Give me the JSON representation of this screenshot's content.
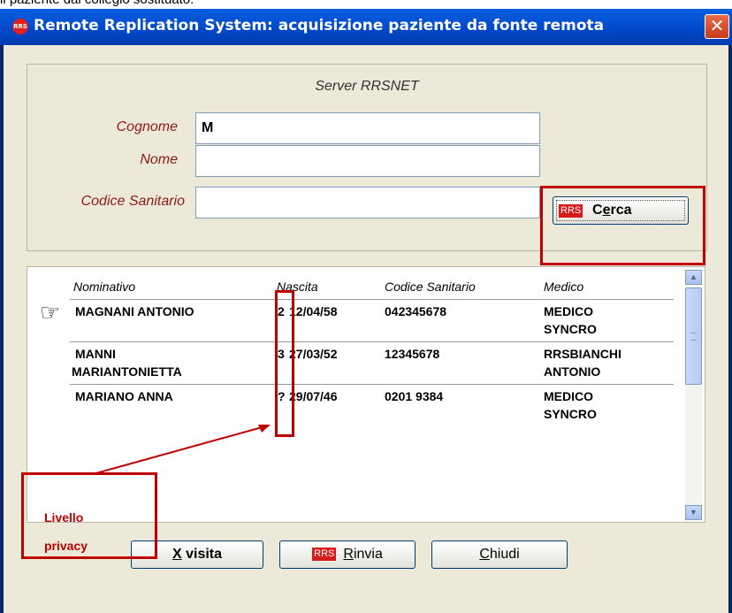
{
  "caption": "il paziente dal collegio sostituato.",
  "window": {
    "title": "Remote Replication System: acquisizione paziente da fonte remota",
    "icon_text": "RRS",
    "close_glyph": "✕"
  },
  "search": {
    "server_label": "Server RRSNET",
    "cognome_label": "Cognome",
    "cognome_value": "M",
    "nome_label": "Nome",
    "nome_value": "",
    "codice_label": "Codice Sanitario",
    "codice_value": "",
    "cerca_logo": "RRS",
    "cerca_prefix": "C",
    "cerca_underline": "e",
    "cerca_suffix": "rca"
  },
  "list": {
    "headers": {
      "nominativo": "Nominativo",
      "nascita": "Nascita",
      "codice": "Codice Sanitario",
      "medico": "Medico"
    },
    "rows": [
      {
        "nome_line1": "MAGNANI ANTONIO",
        "nome_line2": "",
        "privacy": "2",
        "nascita": "12/04/58",
        "codice": "042345678",
        "medico_line1": "MEDICO",
        "medico_line2": "SYNCRO"
      },
      {
        "nome_line1": "MANNI",
        "nome_line2": "MARIANTONIETTA",
        "privacy": "3",
        "nascita": "27/03/52",
        "codice": "12345678",
        "medico_line1": "RRSBIANCHI",
        "medico_line2": "ANTONIO"
      },
      {
        "nome_line1": "MARIANO ANNA",
        "nome_line2": "",
        "privacy": "?",
        "nascita": "29/07/46",
        "codice": "0201 9384",
        "medico_line1": "MEDICO",
        "medico_line2": "SYNCRO"
      }
    ]
  },
  "annotation": {
    "line1": "Livello",
    "line2": "privacy",
    "color": "#c00000"
  },
  "buttons": {
    "visita_underline": "X",
    "visita_suffix": " visita",
    "rinvia_logo": "RRS",
    "rinvia_underline": "R",
    "rinvia_suffix": "invia",
    "chiudi_underline": "C",
    "chiudi_suffix": "hiudi"
  },
  "colors": {
    "titlebar": "#0047c8",
    "dialog_bg": "#ece9d8",
    "label_red": "#8b1a1a",
    "highlight_red": "#c00000"
  }
}
